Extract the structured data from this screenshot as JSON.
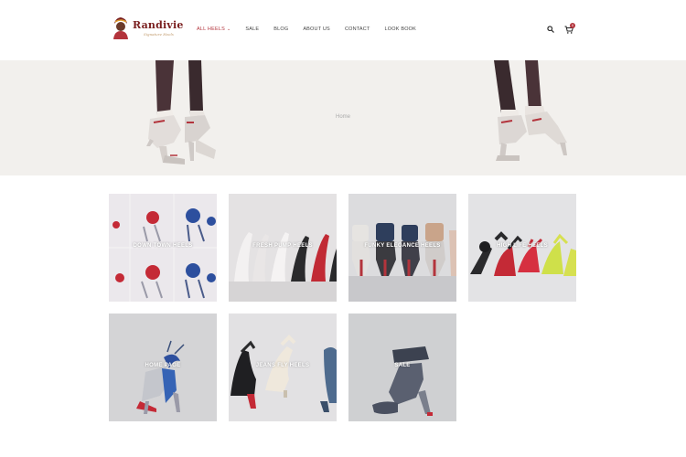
{
  "brand": {
    "name": "Randivie",
    "tagline": "Signature Heels"
  },
  "nav": {
    "items": [
      {
        "label": "ALL HEELS",
        "active": true,
        "has_dropdown": true
      },
      {
        "label": "SALE"
      },
      {
        "label": "BLOG"
      },
      {
        "label": "ABOUT US"
      },
      {
        "label": "CONTACT"
      },
      {
        "label": "LOOK BOOK"
      }
    ]
  },
  "header_icons": {
    "search": "search-icon",
    "cart": "cart-icon",
    "cart_count": "0"
  },
  "hero": {
    "breadcrumb": "Home"
  },
  "categories": [
    {
      "label": "DOWN TOWN HEELS",
      "bg": "#ebe8ec"
    },
    {
      "label": "FRESH PUMP HEELS",
      "bg": "#e4e2e3"
    },
    {
      "label": "FUNKY ELEGANCE HEELS",
      "bg": "#dcdcde"
    },
    {
      "label": "HIGH LIFE HEELS",
      "bg": "#e3e3e5"
    },
    {
      "label": "HOME PAGE",
      "bg": "#d4d4d6"
    },
    {
      "label": "JEANS FLY HEELS",
      "bg": "#e2e1e3"
    },
    {
      "label": "SALE",
      "bg": "#cfd0d2"
    }
  ],
  "colors": {
    "accent": "#b3343c",
    "hero_bg": "#f2f0ed"
  }
}
